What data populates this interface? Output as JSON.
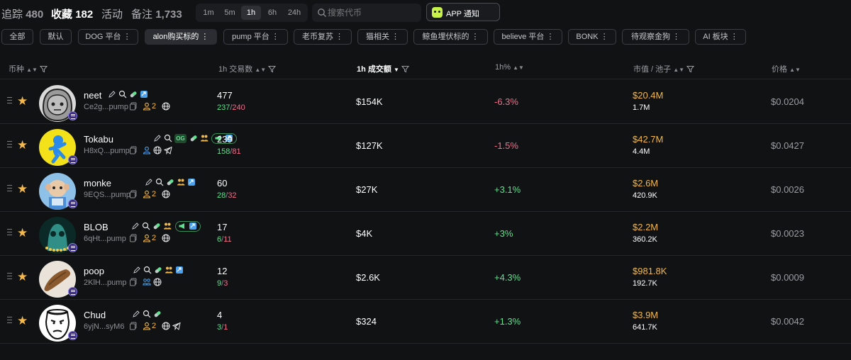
{
  "nav": {
    "tabs": [
      {
        "label": "追踪",
        "count": "480"
      },
      {
        "label": "收藏",
        "count": "182"
      },
      {
        "label": "活动",
        "count": ""
      },
      {
        "label": "备注",
        "count": "1,733"
      }
    ],
    "active_tab": "收藏",
    "timeframes": [
      "1m",
      "5m",
      "1h",
      "6h",
      "24h"
    ],
    "active_timeframe": "1h",
    "search_placeholder": "搜索代币",
    "app_notify_label": "APP 通知"
  },
  "chips": [
    "全部",
    "默认",
    "DOG 平台 ⋮",
    "alon购买标的 ⋮",
    "pump 平台 ⋮",
    "老币复苏 ⋮",
    "猫相关 ⋮",
    "鲸鱼埋伏标的 ⋮",
    "believe 平台 ⋮",
    "BONK ⋮",
    "待观察金狗 ⋮",
    "AI 板块 ⋮"
  ],
  "active_chip": "alon购买标的 ⋮",
  "columns": {
    "token": "币种",
    "tx_count": "1h 交易数",
    "volume": "1h 成交额",
    "change": "1h%",
    "mcap": "市值 / 池子",
    "price": "价格"
  },
  "rows": [
    {
      "name": "neet",
      "addr": "Ce2g...pump",
      "holders": "2",
      "tx": "477",
      "buys": "237",
      "sells": "240",
      "volume": "$154K",
      "change": "-6.3%",
      "change_dir": "neg",
      "mcap": "$20.4M",
      "pool": "1.7M",
      "price": "$0.0204"
    },
    {
      "name": "Tokabu",
      "addr": "H8xQ...pump",
      "holders": "",
      "og": "OG",
      "tx": "239",
      "buys": "158",
      "sells": "81",
      "volume": "$127K",
      "change": "-1.5%",
      "change_dir": "neg",
      "mcap": "$42.7M",
      "pool": "4.4M",
      "price": "$0.0427"
    },
    {
      "name": "monke",
      "addr": "9EQS...pump",
      "holders": "2",
      "tx": "60",
      "buys": "28",
      "sells": "32",
      "volume": "$27K",
      "change": "+3.1%",
      "change_dir": "pos",
      "mcap": "$2.6M",
      "pool": "420.9K",
      "price": "$0.0026"
    },
    {
      "name": "BLOB",
      "addr": "6qHt...pump",
      "holders": "2",
      "tx": "17",
      "buys": "6",
      "sells": "11",
      "volume": "$4K",
      "change": "+3%",
      "change_dir": "pos",
      "mcap": "$2.2M",
      "pool": "360.2K",
      "price": "$0.0023"
    },
    {
      "name": "poop",
      "addr": "2KlH...pump",
      "holders": "",
      "tx": "12",
      "buys": "9",
      "sells": "3",
      "volume": "$2.6K",
      "change": "+4.3%",
      "change_dir": "pos",
      "mcap": "$981.8K",
      "pool": "192.7K",
      "price": "$0.0009"
    },
    {
      "name": "Chud",
      "addr": "6yjN...syM6",
      "holders": "2",
      "tx": "4",
      "buys": "3",
      "sells": "1",
      "volume": "$324",
      "change": "+1.3%",
      "change_dir": "pos",
      "mcap": "$3.9M",
      "pool": "641.7K",
      "price": "$0.0042"
    }
  ],
  "colors": {
    "background": "#111214",
    "buy_green": "#5fe08f",
    "sell_red": "#f0708a",
    "mcap_gold": "#f2b84b",
    "star": "#f2b84b"
  }
}
